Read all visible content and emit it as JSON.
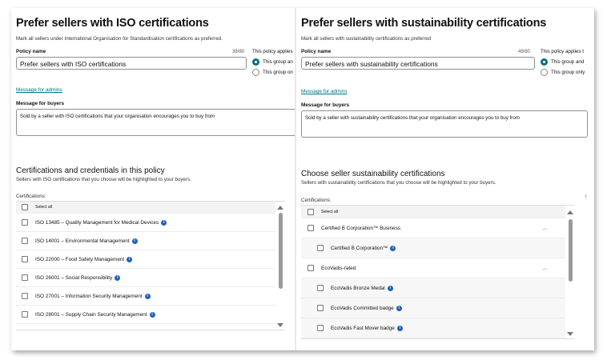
{
  "left": {
    "title": "Prefer sellers with ISO certifications",
    "description": "Mark all sellers under International Organisation for Standardisation certifications as preferred.",
    "policy_name_label": "Policy name",
    "counter": "38/80",
    "policy_name_value": "Prefer sellers with ISO certifications",
    "applies_label": "This policy applies",
    "radio_1": "This group an",
    "radio_2": "This group on",
    "message_admins_link": "Message for admins",
    "message_buyers_label": "Message for buyers",
    "message_buyers_value": "Sold by a seller with ISO certifications that your organisation encourages you to buy from",
    "section_title": "Certifications and credentials in this policy",
    "section_desc": "Sellers with ISO certifications that you choose will be highlighted to your buyers.",
    "cert_label": "Certifications:",
    "select_all": "Select all",
    "items": [
      "ISO 13485 – Quality Management for Medical Devices",
      "ISO 14001 – Environmental Management",
      "ISO 22000 – Food Safety Management",
      "ISO 26001 – Social Responsibility",
      "ISO 27001 – Information Security Management",
      "ISO 28001 – Supply Chain Security Management"
    ]
  },
  "right": {
    "title": "Prefer sellers with sustainability certifications",
    "description": "Mark all sellers with sustainability certifications as preferred",
    "policy_name_label": "Policy name",
    "counter": "49/80",
    "policy_name_value": "Prefer sellers with sustainability certifications",
    "applies_label": "This policy applies t",
    "radio_1": "This group and",
    "radio_2": "This group only",
    "message_admins_link": "Message for admins",
    "message_buyers_label": "Message for buyers",
    "message_buyers_value": "Sold by a seller with sustainability certifications that your organisation encourages you to buy from",
    "section_title": "Choose seller sustainability certifications",
    "section_desc": "Sellers with sustainability certifications that you choose will be highlighted to your buyers.",
    "cert_label": "Certifications:",
    "select_all": "Select all",
    "groups": [
      {
        "label": "Certified B Corporation™ Business",
        "children": [
          "Certified B Corporation™"
        ]
      },
      {
        "label": "EcoVadis-rated",
        "children": [
          "EcoVadis Bronze Medal",
          "EcoVadis Committed badge",
          "EcoVadis Fast Mover badge"
        ]
      }
    ]
  },
  "colors": {
    "accent": "#007185",
    "info": "#1f5fbf"
  },
  "icons": [
    "info-icon",
    "chevron-up-icon",
    "scroll-up-arrow-icon",
    "scroll-down-arrow-icon"
  ]
}
